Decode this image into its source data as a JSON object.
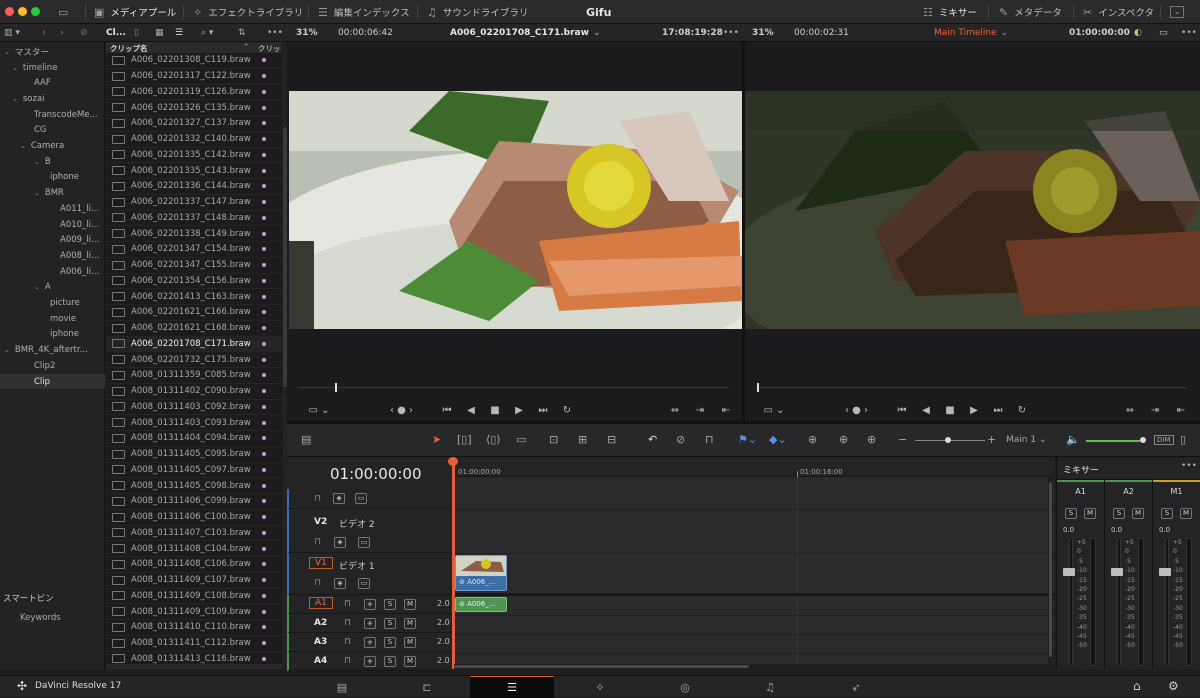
{
  "app": {
    "title": "Gifu",
    "name": "DaVinci Resolve 17"
  },
  "topbar": {
    "media_pool": "メディアプール",
    "effects": "エフェクトライブラリ",
    "edit_index": "編集インデックス",
    "sound_library": "サウンドライブラリ",
    "mixer": "ミキサー",
    "metadata": "メタデータ",
    "inspector": "インスペクタ"
  },
  "source_viewer": {
    "zoom": "31%",
    "timecode_left": "00:00:06:42",
    "clip_name": "A006_02201708_C171.braw",
    "timecode_right": "17:08:19:28"
  },
  "timeline_viewer": {
    "zoom": "31%",
    "timecode_left": "00:00:02:31",
    "timeline_name": "Main Timeline",
    "timecode_right": "01:00:00:00"
  },
  "bin_panel": {
    "header": "Cl...",
    "tree": [
      "マスター",
      "timeline",
      "AAF",
      "sozai",
      "TranscodeMe...",
      "CG",
      "Camera",
      "B",
      "iphone",
      "BMR",
      "A011_li...",
      "A010_li...",
      "A009_li...",
      "A008_li...",
      "A006_li...",
      "A",
      "picture",
      "movie",
      "iphone",
      "BMR_4K_aftertr...",
      "Clip2",
      "Clip"
    ],
    "smart_bin": "スマートビン",
    "keywords": "Keywords"
  },
  "clip_list": {
    "col_name": "クリップ名",
    "col_extra": "クリッ",
    "clips": [
      "A006_02201308_C119.braw",
      "A006_02201317_C122.braw",
      "A006_02201319_C126.braw",
      "A006_02201326_C135.braw",
      "A006_02201327_C137.braw",
      "A006_02201332_C140.braw",
      "A006_02201335_C142.braw",
      "A006_02201335_C143.braw",
      "A006_02201336_C144.braw",
      "A006_02201337_C147.braw",
      "A006_02201337_C148.braw",
      "A006_02201338_C149.braw",
      "A006_02201347_C154.braw",
      "A006_02201347_C155.braw",
      "A006_02201354_C156.braw",
      "A006_02201413_C163.braw",
      "A006_02201621_C166.braw",
      "A006_02201621_C168.braw",
      "A006_02201708_C171.braw",
      "A006_02201732_C175.braw",
      "A008_01311359_C085.braw",
      "A008_01311402_C090.braw",
      "A008_01311403_C092.braw",
      "A008_01311403_C093.braw",
      "A008_01311404_C094.braw",
      "A008_01311405_C095.braw",
      "A008_01311405_C097.braw",
      "A008_01311405_C098.braw",
      "A008_01311406_C099.braw",
      "A008_01311406_C100.braw",
      "A008_01311407_C103.braw",
      "A008_01311408_C104.braw",
      "A008_01311408_C106.braw",
      "A008_01311409_C107.braw",
      "A008_01311409_C108.braw",
      "A008_01311409_C109.braw",
      "A008_01311410_C110.braw",
      "A008_01311411_C112.braw",
      "A008_01311413_C116.braw"
    ]
  },
  "timeline": {
    "timecode": "01:00:00:00",
    "ruler_start": "01:00:00:00",
    "ruler_mid": "01:00:16:00",
    "track_name_zoom": "Main 1",
    "tracks": {
      "v2": "V2",
      "v2_name": "ビデオ 2",
      "v1": "V1",
      "v1_name": "ビデオ 1",
      "a1": "A1",
      "a2": "A2",
      "a3": "A3",
      "a4": "A4",
      "level": "2.0"
    },
    "clip_label": "A006_..."
  },
  "mixer": {
    "title": "ミキサー",
    "channels": [
      "A1",
      "A2",
      "M1"
    ],
    "level": "0.0",
    "scale": [
      "+5",
      "0",
      "-5",
      "-10",
      "-15",
      "-20",
      "-25",
      "-30",
      "-35",
      "-40",
      "-45",
      "-50"
    ]
  },
  "labels": {
    "solo": "S",
    "mute": "M",
    "dim": "DIM"
  }
}
